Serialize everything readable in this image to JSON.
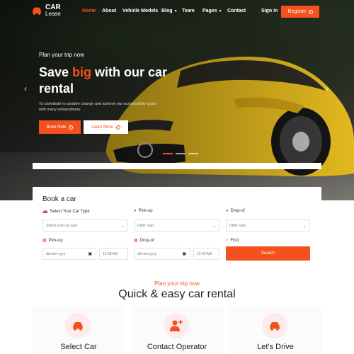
{
  "brand": {
    "name_line1": "CAR",
    "name_line2": "Lease",
    "accent": "#f4511e"
  },
  "nav": {
    "items": [
      {
        "label": "Home",
        "active": true
      },
      {
        "label": "About"
      },
      {
        "label": "Vehicle Models"
      },
      {
        "label": "Blog",
        "dropdown": true
      },
      {
        "label": "Team"
      },
      {
        "label": "Pages",
        "dropdown": true
      },
      {
        "label": "Contact"
      }
    ],
    "signin": "Sign in",
    "register": "Register"
  },
  "hero": {
    "eyebrow": "Plan your trip now",
    "headline_pre": "Save ",
    "headline_accent": "big",
    "headline_post": " with our car rental",
    "subtext": "To contribute to positive change and achieve our sustainability goals with many extraordinary",
    "book_ride": "Book Ride",
    "learn_more": "Learn More"
  },
  "booking": {
    "title": "Book a car",
    "car_type_label": "Select Your Car Type",
    "car_type_placeholder": "Select your car type",
    "pickup_label": "Pick-up",
    "pickup_value": "Delhi road",
    "dropoff_label": "Drop-of",
    "dropoff_value": "Delhi road",
    "pickup_date_label": "Pick-up",
    "date_placeholder": "dd-mm-yyyy",
    "time_placeholder": "12:00 AM",
    "dropoff_date_label": "Drop-of",
    "find_label": "Find",
    "search": "Search"
  },
  "features": {
    "eyebrow": "Plan your trip now",
    "title": "Quick & easy car rental",
    "items": [
      {
        "title": "Select Car",
        "icon": "car-icon"
      },
      {
        "title": "Contact Operator",
        "icon": "operator-icon"
      },
      {
        "title": "Let's Drive",
        "icon": "car-icon"
      }
    ]
  }
}
